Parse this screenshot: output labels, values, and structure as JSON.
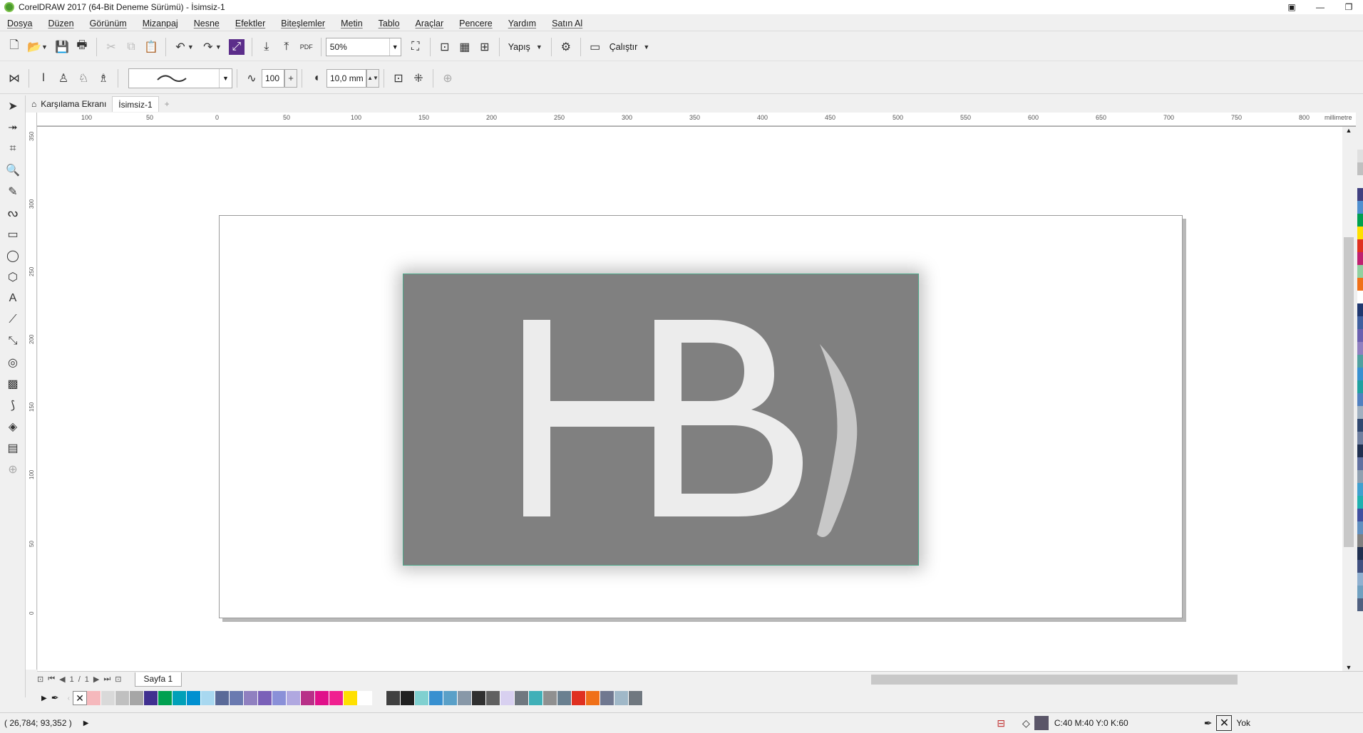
{
  "window": {
    "title": "CorelDRAW 2017 (64-Bit Deneme Sürümü) - İsimsiz-1"
  },
  "menu": [
    "Dosya",
    "Düzen",
    "Görünüm",
    "Mizanpaj",
    "Nesne",
    "Efektler",
    "Biteşlemler",
    "Metin",
    "Tablo",
    "Araçlar",
    "Pencere",
    "Yardım",
    "Satın Al"
  ],
  "toolbar": {
    "zoom": "50%",
    "snap_label": "Yapış",
    "launch_label": "Çalıştır",
    "pdf_label": "PDF"
  },
  "property_bar": {
    "smoothing": "100",
    "size": "10,0 mm"
  },
  "tabs": {
    "welcome": "Karşılama Ekranı",
    "document": "İsimsiz-1"
  },
  "ruler": {
    "unit": "millimetre",
    "h_labels": [
      "100",
      "50",
      "0",
      "50",
      "100",
      "150",
      "200",
      "250",
      "300",
      "350",
      "400",
      "450",
      "500",
      "550",
      "600",
      "650",
      "700",
      "750",
      "800"
    ],
    "v_labels": [
      "350",
      "300",
      "250",
      "200",
      "150",
      "100",
      "50",
      "0"
    ]
  },
  "canvas": {
    "logo_letters": "HB",
    "logo_bg": "#808080",
    "logo_fg": "#ececec"
  },
  "page_nav": {
    "current": "1",
    "separator": "/",
    "total": "1",
    "page_name": "Sayfa 1"
  },
  "status": {
    "coords": "( 26,784; 93,352 )",
    "fill_color": "C:40 M:40 Y:0 K:60",
    "outline": "Yok"
  },
  "palette_colors": [
    "#f5b8bc",
    "#d9d9d9",
    "#c0c0c0",
    "#a6a6a6",
    "#403090",
    "#00a050",
    "#00a0b8",
    "#0090d0",
    "#a8d8f0",
    "#5a6a98",
    "#6a7ab0",
    "#9080c0",
    "#7a60b8",
    "#8a90d8",
    "#b0a8e0",
    "#b83088",
    "#e0108a",
    "#f02090",
    "#ffe000",
    "#ffffff",
    "#f0f0f0",
    "#404040",
    "#202020",
    "#80d0d0",
    "#3890d0",
    "#5aa0c8",
    "#8898a8",
    "#303030",
    "#606060",
    "#d8d0f0",
    "#707880",
    "#40b0b8",
    "#909090",
    "#6a8090",
    "#e03020",
    "#f07018",
    "#707890",
    "#a0b8c8",
    "#707880"
  ],
  "right_palette": [
    "#e0e0e0",
    "#c0c0c0",
    "#f0f0f0",
    "#404080",
    "#5090d0",
    "#00a050",
    "#ffe000",
    "#e03020",
    "#c02070",
    "#90d0a0",
    "#f07018",
    "#ffffff",
    "#203870",
    "#4060a0",
    "#6a60b0",
    "#9080c0",
    "#50a0a0",
    "#3890d0",
    "#20a0a0",
    "#5080c0",
    "#a0b0c0",
    "#304870",
    "#7080a0",
    "#203050",
    "#6070a0",
    "#90a0b0",
    "#40a0d0",
    "#20b0b0",
    "#4050a0",
    "#6090c0",
    "#808080",
    "#203050",
    "#405080",
    "#90b0d0",
    "#70a0c0",
    "#506080"
  ]
}
